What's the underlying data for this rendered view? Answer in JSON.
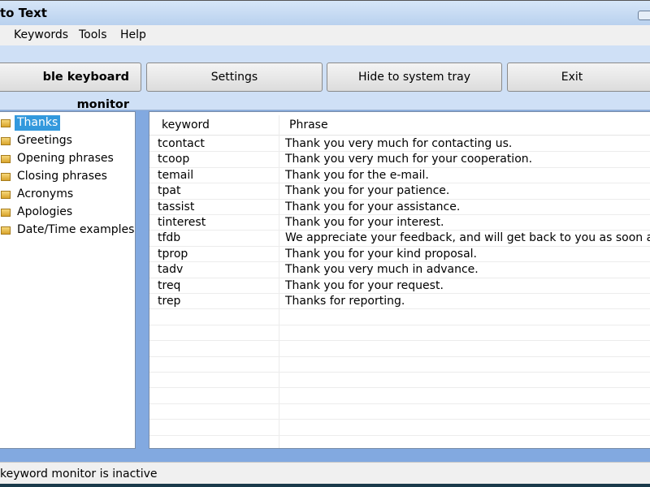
{
  "window": {
    "title": "to Text"
  },
  "menu": [
    "Keywords",
    "Tools",
    "Help"
  ],
  "toolbar": {
    "monitor": "ble keyboard monitor",
    "settings": "Settings",
    "hide": "Hide to system tray",
    "exit": "Exit"
  },
  "categories": [
    {
      "label": "Thanks",
      "selected": true
    },
    {
      "label": "Greetings"
    },
    {
      "label": "Opening phrases"
    },
    {
      "label": "Closing phrases"
    },
    {
      "label": "Acronyms"
    },
    {
      "label": "Apologies"
    },
    {
      "label": "Date/Time examples"
    }
  ],
  "table": {
    "headers": {
      "keyword": "keyword",
      "phrase": "Phrase"
    },
    "rows": [
      {
        "k": "tcontact",
        "p": "Thank you very much for contacting us."
      },
      {
        "k": "tcoop",
        "p": "Thank you very much for your cooperation."
      },
      {
        "k": "temail",
        "p": "Thank you for the e-mail."
      },
      {
        "k": "tpat",
        "p": "Thank you for your patience."
      },
      {
        "k": "tassist",
        "p": "Thank you for your assistance."
      },
      {
        "k": "tinterest",
        "p": "Thank you for your interest."
      },
      {
        "k": "tfdb",
        "p": "We appreciate your feedback, and will get back to you as soon as ..."
      },
      {
        "k": "tprop",
        "p": "Thank you for your kind proposal."
      },
      {
        "k": "tadv",
        "p": "Thank you very much in advance."
      },
      {
        "k": "treq",
        "p": "Thank you for your request."
      },
      {
        "k": "trep",
        "p": "Thanks for reporting."
      }
    ]
  },
  "status": "keyword monitor is inactive"
}
